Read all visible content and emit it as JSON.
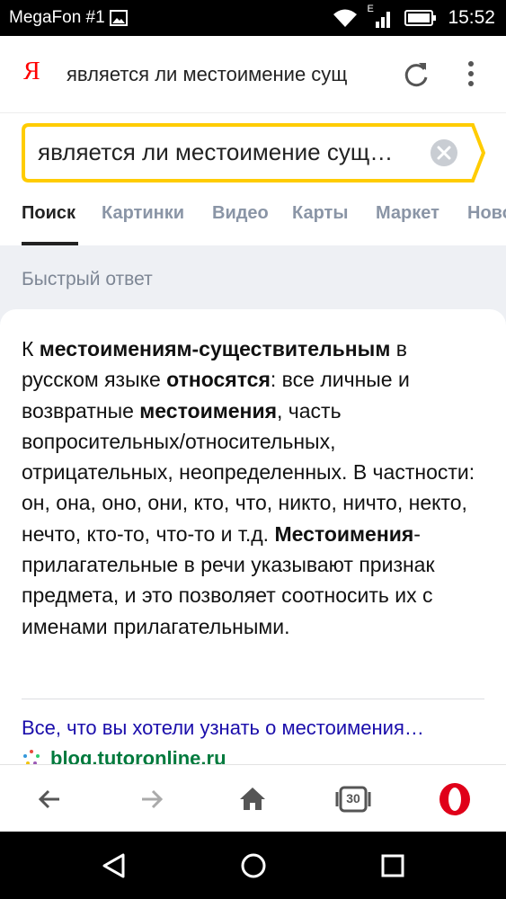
{
  "status_bar": {
    "carrier": "MegaFon #1",
    "network_type": "E",
    "time": "15:52"
  },
  "browser": {
    "logo": "Я",
    "url_title": "является ли местоимение сущ"
  },
  "search": {
    "query": "является ли местоимение сущ…"
  },
  "tabs": [
    {
      "label": "Поиск",
      "active": true
    },
    {
      "label": "Картинки",
      "active": false
    },
    {
      "label": "Видео",
      "active": false
    },
    {
      "label": "Карты",
      "active": false
    },
    {
      "label": "Маркет",
      "active": false
    },
    {
      "label": "Ново",
      "active": false
    }
  ],
  "quick_answer": {
    "title": "Быстрый ответ",
    "segments": [
      {
        "text": "К ",
        "bold": false
      },
      {
        "text": "местоимениям-существительным",
        "bold": true
      },
      {
        "text": " в русском языке ",
        "bold": false
      },
      {
        "text": "относятся",
        "bold": true
      },
      {
        "text": ": все личные и возвратные ",
        "bold": false
      },
      {
        "text": "местоимения",
        "bold": true
      },
      {
        "text": ", часть вопросительных/относительных, отрицательных, неопределенных. В частности: он, она, оно, они, кто, что, никто, ничто, некто, нечто, кто-то, что-то и т.д. ",
        "bold": false
      },
      {
        "text": "Местоимения",
        "bold": true
      },
      {
        "text": "-прилагательные в речи указывают признак предмета, и это позволяет соотносить их с именами прилагательными.",
        "bold": false
      }
    ],
    "source_title": "Все, что вы хотели узнать о местоимения…",
    "source_domain": "blog.tutoronline.ru"
  },
  "toolbar": {
    "tabs_count": "30"
  },
  "colors": {
    "yandex_red": "#ff0000",
    "search_border": "#ffcc00",
    "link": "#1a0dab",
    "domain_green": "#007a3d",
    "opera_red": "#e00019"
  },
  "icons": [
    "image-icon",
    "wifi-icon",
    "signal-icon",
    "battery-icon",
    "reload-icon",
    "more-vert-icon",
    "clear-icon",
    "back-icon",
    "forward-icon",
    "home-icon",
    "tabs-icon",
    "opera-icon",
    "nav-back-icon",
    "nav-home-icon",
    "nav-recents-icon"
  ]
}
